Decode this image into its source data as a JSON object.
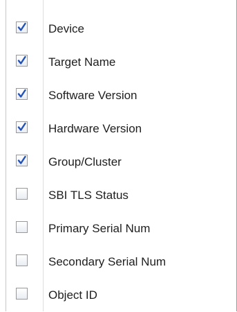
{
  "columns": [
    {
      "label": "Device",
      "checked": true
    },
    {
      "label": "Target Name",
      "checked": true
    },
    {
      "label": "Software Version",
      "checked": true
    },
    {
      "label": "Hardware Version",
      "checked": true
    },
    {
      "label": "Group/Cluster",
      "checked": true
    },
    {
      "label": "SBI TLS Status",
      "checked": false
    },
    {
      "label": "Primary Serial Num",
      "checked": false
    },
    {
      "label": "Secondary Serial Num",
      "checked": false
    },
    {
      "label": "Object ID",
      "checked": false
    }
  ],
  "colors": {
    "check": "#2350b9",
    "text": "#1e1e1e",
    "border": "#8f9aa5"
  },
  "icons": {
    "checked": "checkmark-icon"
  }
}
